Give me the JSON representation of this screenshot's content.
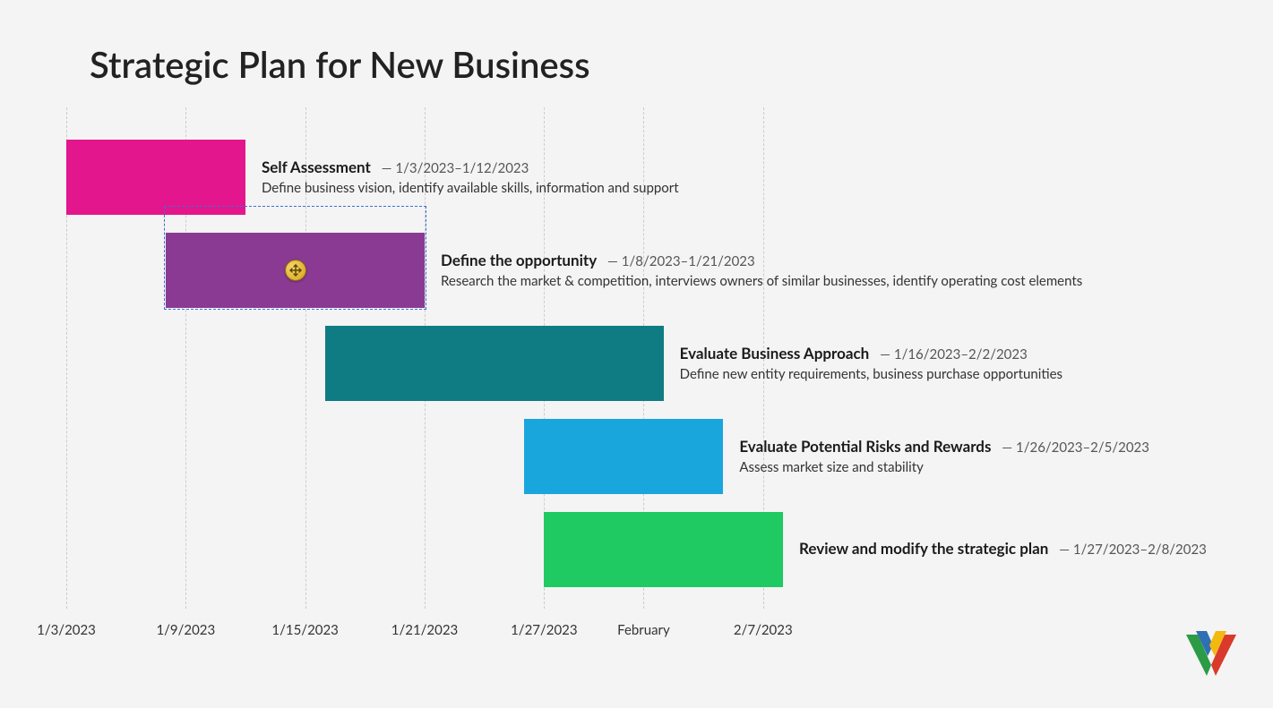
{
  "title": "Strategic Plan for New Business",
  "chart_data": {
    "type": "bar",
    "title": "Strategic Plan for New Business",
    "xlabel": "",
    "ylabel": "",
    "x_ticks": [
      "1/3/2023",
      "1/9/2023",
      "1/15/2023",
      "1/21/2023",
      "1/27/2023",
      "February",
      "2/7/2023"
    ],
    "series": [
      {
        "name": "Self Assessment",
        "start": "1/3/2023",
        "end": "1/12/2023",
        "description": "Define business vision, identify available skills, information and support",
        "color": "#e3168d"
      },
      {
        "name": "Define the opportunity",
        "start": "1/8/2023",
        "end": "1/21/2023",
        "description": "Research the market & competition, interviews owners of similar businesses, identify operating cost elements",
        "color": "#8a3a92"
      },
      {
        "name": "Evaluate Business Approach",
        "start": "1/16/2023",
        "end": "2/2/2023",
        "description": "Define new entity requirements, business purchase opportunities",
        "color": "#0e7c82"
      },
      {
        "name": "Evaluate Potential Risks and Rewards",
        "start": "1/26/2023",
        "end": "2/5/2023",
        "description": "Assess market size and stability",
        "color": "#19a6dc"
      },
      {
        "name": "Review and modify the strategic plan",
        "start": "1/27/2023",
        "end": "2/8/2023",
        "description": "",
        "color": "#1fca63"
      }
    ],
    "selected_index": 1
  },
  "date_separator": "–",
  "title_date_separator": " — "
}
